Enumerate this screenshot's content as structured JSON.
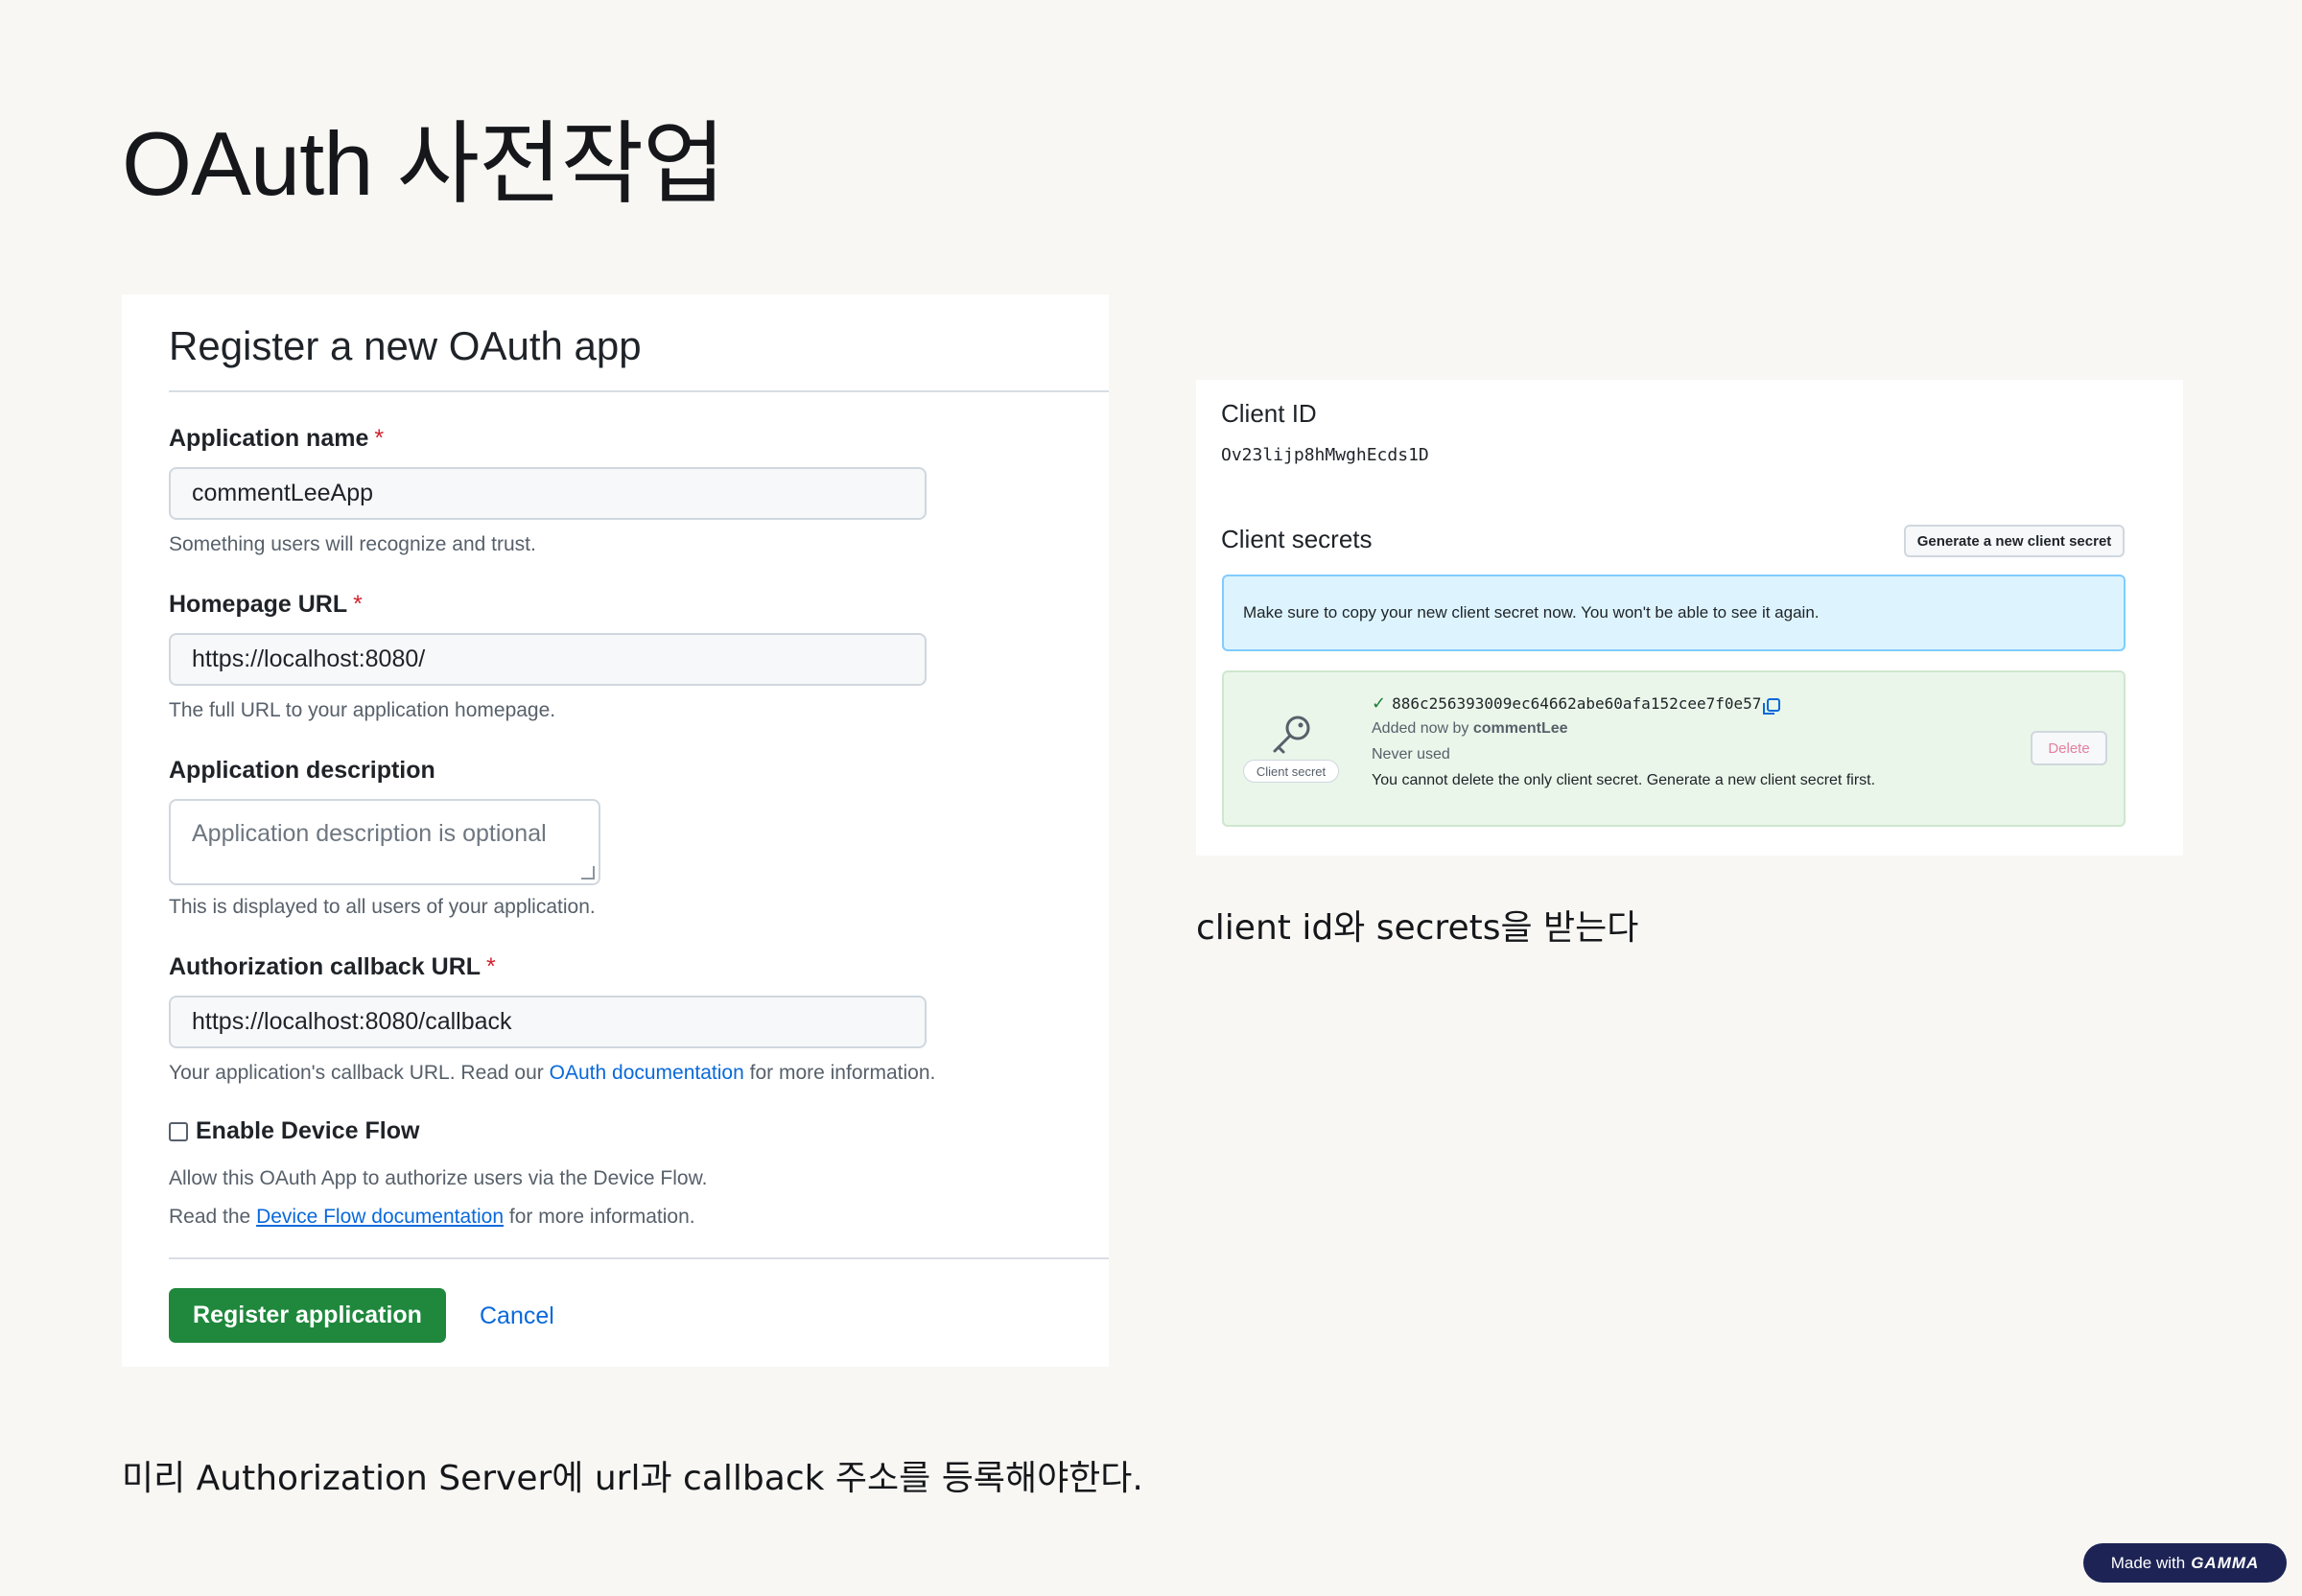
{
  "slide": {
    "title": "OAuth 사전작업",
    "caption_left": "미리 Authorization Server에 url과 callback 주소를 등록해야한다.",
    "caption_right": "client id와 secrets을 받는다"
  },
  "register_form": {
    "heading": "Register a new OAuth app",
    "required_mark": "*",
    "app_name_label": "Application name",
    "app_name_value": "commentLeeApp",
    "app_name_hint": "Something users will recognize and trust.",
    "homepage_label": "Homepage URL",
    "homepage_value": "https://localhost:8080/",
    "homepage_hint": "The full URL to your application homepage.",
    "description_label": "Application description",
    "description_placeholder": "Application description is optional",
    "description_hint": "This is displayed to all users of your application.",
    "callback_label": "Authorization callback URL",
    "callback_value": "https://localhost:8080/callback",
    "callback_hint_prefix": "Your application's callback URL. Read our",
    "callback_hint_link": "OAuth documentation",
    "callback_hint_suffix": "for more information.",
    "device_flow_label": "Enable Device Flow",
    "device_flow_checked": false,
    "device_flow_hint_1": "Allow this OAuth App to authorize users via the Device Flow.",
    "device_flow_hint_2_prefix": "Read the",
    "device_flow_hint_2_link": "Device Flow documentation",
    "device_flow_hint_2_suffix": "for more information.",
    "register_button": "Register application",
    "cancel_link": "Cancel",
    "colors": {
      "primary_button": "#1f883d",
      "link": "#0969da",
      "required": "#d1242f"
    }
  },
  "client_credentials": {
    "client_id_label": "Client ID",
    "client_id_value": "Ov23lijp8hMwghEcds1D",
    "secrets_label": "Client secrets",
    "generate_button": "Generate a new client secret",
    "flash_message": "Make sure to copy your new client secret now. You won't be able to see it again.",
    "secret_badge": "Client secret",
    "secret_value": "886c256393009ec64662abe60afa152cee7f0e57",
    "added_prefix": "Added now by",
    "added_by": "commentLee",
    "usage": "Never used",
    "delete_note": "You cannot delete the only client secret. Generate a new client secret first.",
    "delete_button": "Delete",
    "icons": [
      "key-icon",
      "check-icon",
      "copy-icon"
    ],
    "colors": {
      "flash_bg": "#ddf4ff",
      "secret_bg": "#eaf6ea",
      "delete_text": "#e57f9d"
    }
  },
  "badge": {
    "made_with": "Made with",
    "brand": "GAMMA"
  }
}
